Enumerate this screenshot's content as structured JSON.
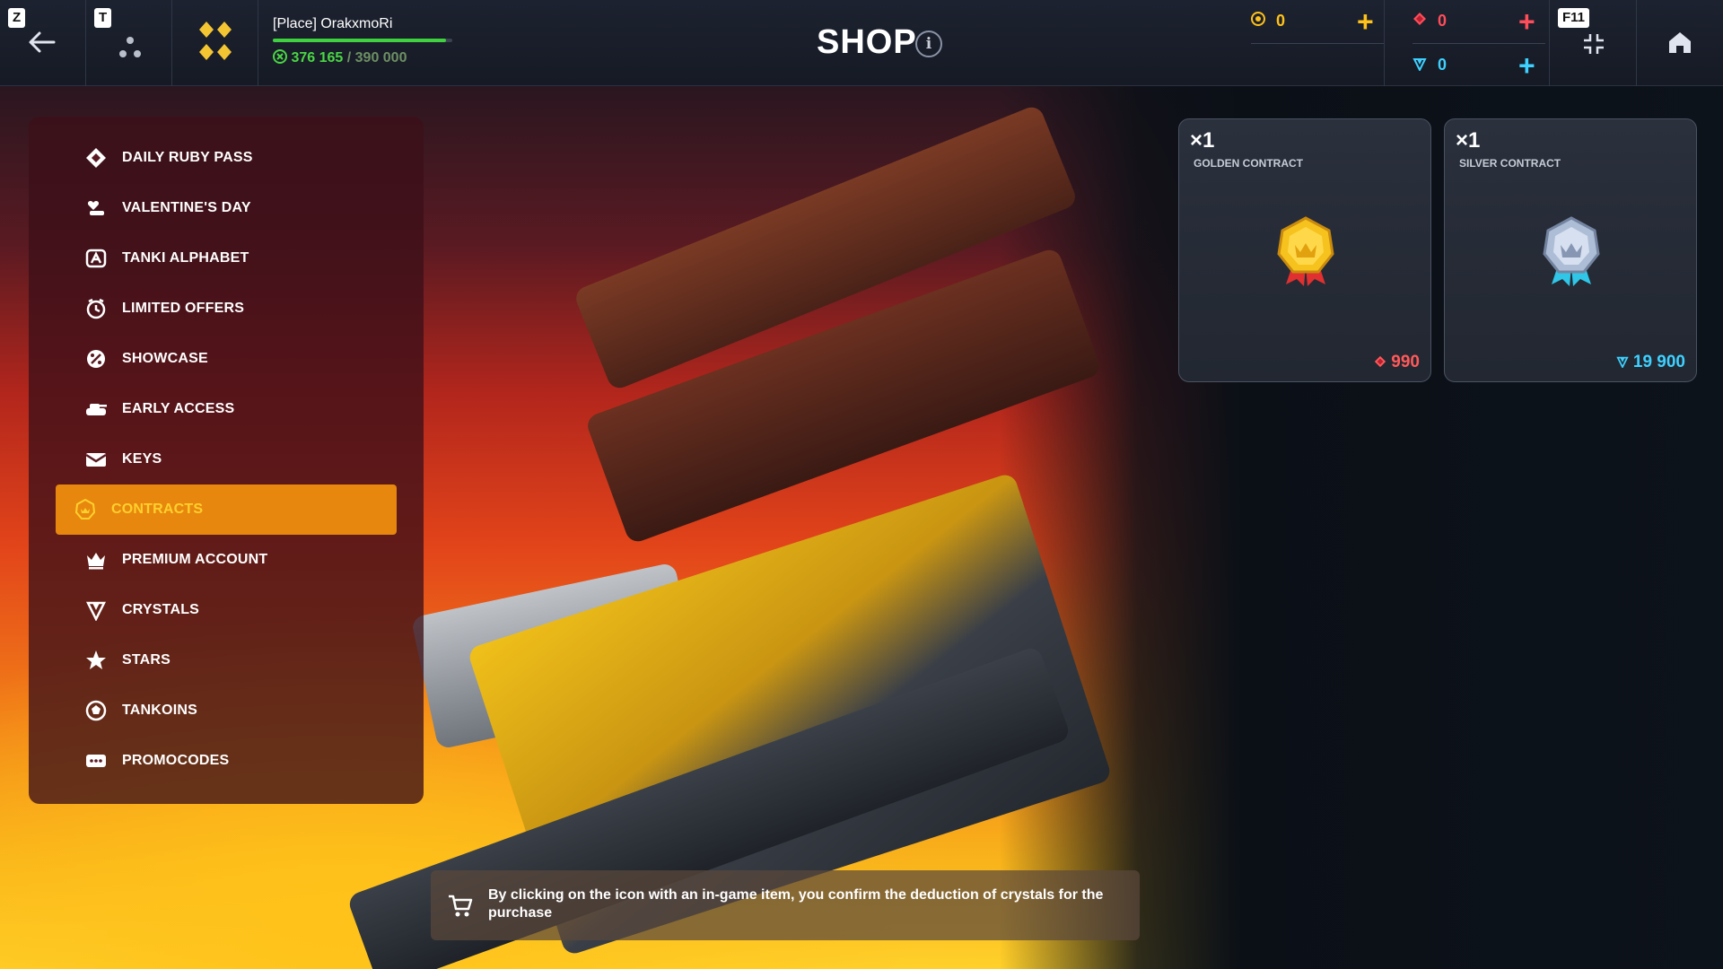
{
  "header": {
    "key_z": "Z",
    "key_t": "T",
    "key_f11": "F11",
    "username": "[Place] OrakxmoRi",
    "xp_current": "376 165",
    "xp_separator": " / ",
    "xp_max": "390 000",
    "xp_progress": 0.9645,
    "title": "SHOP",
    "info": "i",
    "currency_tankoins": "0",
    "currency_rubies": "0",
    "currency_crystals": "0",
    "plus": "+"
  },
  "sidebar": {
    "items": [
      {
        "label": "DAILY RUBY PASS",
        "icon": "ruby-pass-icon"
      },
      {
        "label": "VALENTINE'S DAY",
        "icon": "valentine-icon"
      },
      {
        "label": "TANKI ALPHABET",
        "icon": "alphabet-icon"
      },
      {
        "label": "LIMITED OFFERS",
        "icon": "limited-offers-icon"
      },
      {
        "label": "SHOWCASE",
        "icon": "showcase-icon"
      },
      {
        "label": "EARLY ACCESS",
        "icon": "early-access-icon"
      },
      {
        "label": "KEYS",
        "icon": "keys-icon"
      },
      {
        "label": "CONTRACTS",
        "icon": "contracts-icon",
        "active": true
      },
      {
        "label": "PREMIUM ACCOUNT",
        "icon": "crown-icon"
      },
      {
        "label": "CRYSTALS",
        "icon": "crystal-icon"
      },
      {
        "label": "STARS",
        "icon": "star-icon"
      },
      {
        "label": "TANKOINS",
        "icon": "tankoin-icon"
      },
      {
        "label": "PROMOCODES",
        "icon": "promocode-icon"
      }
    ]
  },
  "cards": [
    {
      "qty": "×1",
      "name": "GOLDEN CONTRACT",
      "price": "990",
      "currency": "ruby",
      "price_color": "#ff5a5a"
    },
    {
      "qty": "×1",
      "name": "SILVER CONTRACT",
      "price": "19 900",
      "currency": "crystal",
      "price_color": "#3ed1ff"
    }
  ],
  "notice": {
    "text": "By clicking on the icon with an in-game item, you confirm the deduction of crystals for the purchase"
  },
  "colors": {
    "accent_orange": "#e7870e",
    "tankoin_yellow": "#ffc21a",
    "ruby_red": "#ff4d5a",
    "crystal_cyan": "#3ed1ff",
    "xp_green": "#3fd13f"
  }
}
